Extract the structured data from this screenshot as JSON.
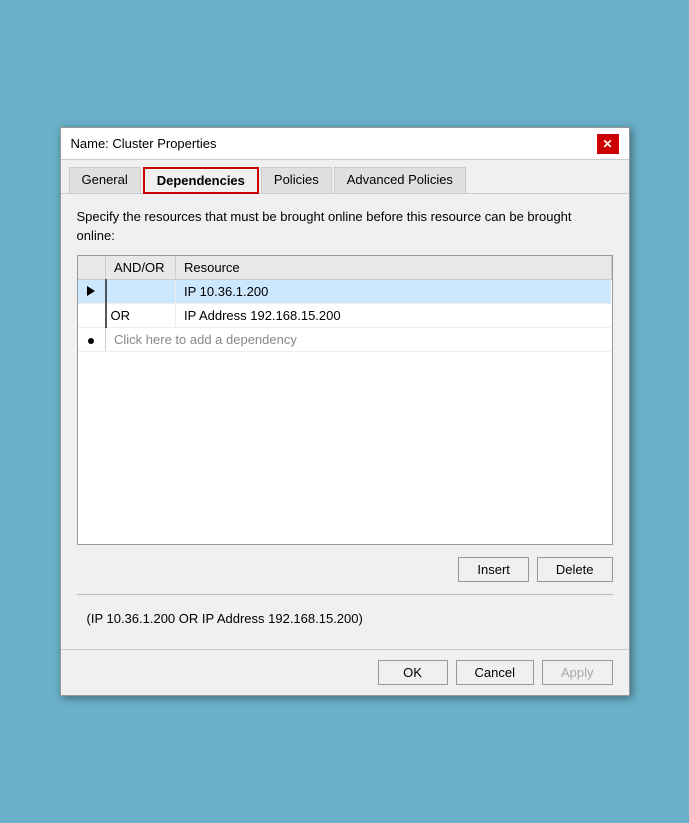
{
  "dialog": {
    "title": "Name: Cluster Properties",
    "close_label": "✕"
  },
  "tabs": [
    {
      "id": "general",
      "label": "General",
      "active": false
    },
    {
      "id": "dependencies",
      "label": "Dependencies",
      "active": true
    },
    {
      "id": "policies",
      "label": "Policies",
      "active": false
    },
    {
      "id": "advanced_policies",
      "label": "Advanced Policies",
      "active": false
    }
  ],
  "description": "Specify the resources that must be brought online before this resource can be brought online:",
  "table": {
    "headers": [
      "",
      "AND/OR",
      "Resource"
    ],
    "rows": [
      {
        "indicator": "arrow",
        "andor": "",
        "resource": "IP 10.36.1.200",
        "selected": true
      },
      {
        "indicator": "",
        "andor": "OR",
        "resource": "IP Address 192.168.15.200",
        "selected": false
      }
    ],
    "add_row_text": "Click here to add a dependency"
  },
  "buttons": {
    "insert_label": "Insert",
    "delete_label": "Delete"
  },
  "expression": "(IP 10.36.1.200  OR  IP Address 192.168.15.200)",
  "footer": {
    "ok_label": "OK",
    "cancel_label": "Cancel",
    "apply_label": "Apply"
  }
}
